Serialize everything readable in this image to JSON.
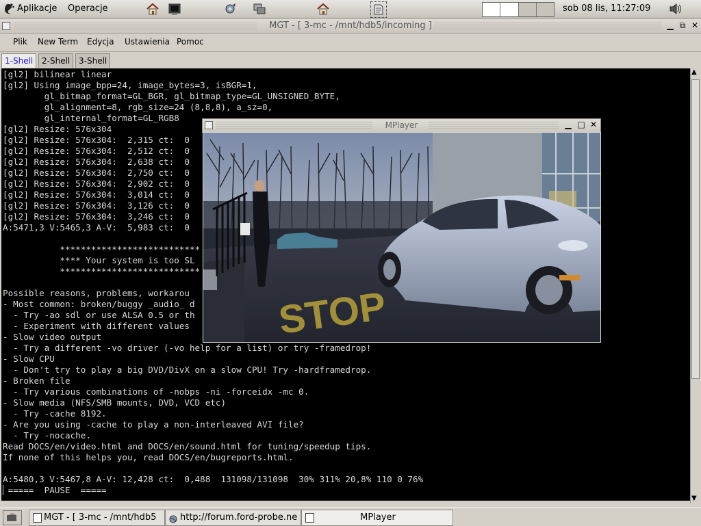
{
  "top_panel": {
    "applications_label": "Aplikacje",
    "actions_label": "Operacje",
    "clock": "sob 08 lis, 11:27:09"
  },
  "main_window": {
    "title": "MGT - [ 3-mc - /mnt/hdb5/incoming ]",
    "menu": [
      "Plik",
      "New Term",
      "Edycja",
      "Ustawienia",
      "Pomoc"
    ],
    "tabs": [
      "1-Shell",
      "2-Shell",
      "3-Shell"
    ],
    "active_tab": "1-Shell"
  },
  "terminal": {
    "lines": [
      "[gl2] bilinear linear",
      "[gl2] Using image_bpp=24, image_bytes=3, isBGR=1,",
      "        gl_bitmap_format=GL_BGR, gl_bitmap_type=GL_UNSIGNED_BYTE,",
      "        gl_alignment=8, rgb_size=24 (8,8,8), a_sz=0,",
      "        gl_internal_format=GL_RGB8",
      "[gl2] Resize: 576x304",
      "[gl2] Resize: 576x304:  2,315 ct:  0",
      "[gl2] Resize: 576x304:  2,512 ct:  0",
      "[gl2] Resize: 576x304:  2,638 ct:  0",
      "[gl2] Resize: 576x304:  2,750 ct:  0",
      "[gl2] Resize: 576x304:  2,902 ct:  0",
      "[gl2] Resize: 576x304:  3,014 ct:  0",
      "[gl2] Resize: 576x304:  3,126 ct:  0",
      "[gl2] Resize: 576x304:  3,246 ct:  0",
      "A:5471,3 V:5465,3 A-V:  5,983 ct:  0",
      "",
      "           ***************************",
      "           **** Your system is too SL",
      "           ***************************",
      "",
      "Possible reasons, problems, workarou",
      "- Most common: broken/buggy _audio_ d",
      "  - Try -ao sdl or use ALSA 0.5 or th",
      "  - Experiment with different values",
      "- Slow video output",
      "  - Try a different -vo driver (-vo help for a list) or try -framedrop!",
      "- Slow CPU",
      "  - Don't try to play a big DVD/DivX on a slow CPU! Try -hardframedrop.",
      "- Broken file",
      "  - Try various combinations of -nobps -ni -forceidx -mc 0.",
      "- Slow media (NFS/SMB mounts, DVD, VCD etc)",
      "  - Try -cache 8192.",
      "- Are you using -cache to play a non-interleaved AVI file?",
      "  - Try -nocache.",
      "Read DOCS/en/video.html and DOCS/en/sound.html for tuning/speedup tips.",
      "If none of this helps you, read DOCS/en/bugreports.html.",
      "",
      "A:5480,3 V:5467,8 A-V: 12,428 ct:  0,488  131098/131098  30% 311% 20,8% 110 0 76%",
      "▏=====  PAUSE  ====="
    ]
  },
  "mplayer": {
    "title": "MPlayer",
    "painted_text": "STOP"
  },
  "taskbar": {
    "tasks": [
      "MGT - [ 3-mc - /mnt/hdb5",
      "http://forum.ford-probe.ne",
      "MPlayer"
    ]
  }
}
